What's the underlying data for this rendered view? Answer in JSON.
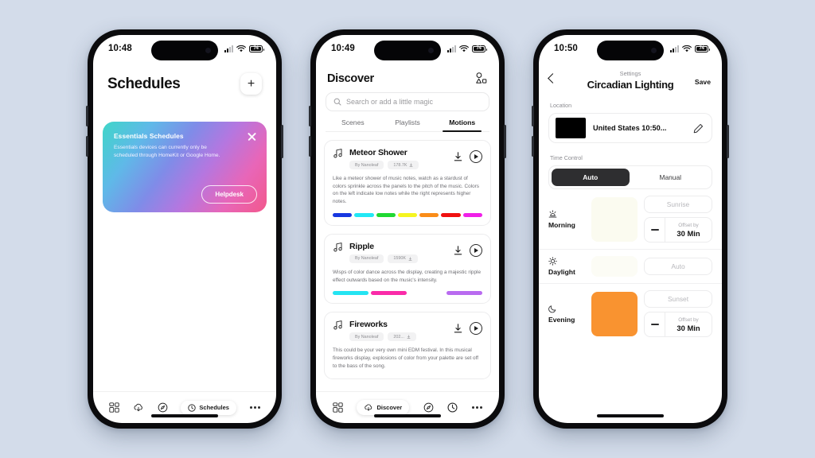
{
  "background_color": "#d3dcea",
  "phone1": {
    "status": {
      "time": "10:48",
      "battery": "74",
      "signal_icon": "signal-bars-icon",
      "wifi_icon": "wifi-icon",
      "battery_icon": "battery-icon"
    },
    "header": {
      "title": "Schedules",
      "add_button_label": "+"
    },
    "promo": {
      "title": "Essentials Schedules",
      "body": "Essentials devices can currently only be scheduled through HomeKit or Google Home.",
      "button_label": "Helpdesk",
      "close_icon": "close-icon",
      "gradient_from": "#3fd6c8",
      "gradient_to": "#f2588c"
    },
    "tabbar": {
      "items": [
        {
          "icon": "grid-icon",
          "label": "",
          "active": false
        },
        {
          "icon": "cloud-download-icon",
          "label": "",
          "active": false
        },
        {
          "icon": "compass-icon",
          "label": "",
          "active": false
        },
        {
          "icon": "clock-icon",
          "label": "Schedules",
          "active": true
        },
        {
          "icon": "more-dots-icon",
          "label": "",
          "active": false
        }
      ]
    }
  },
  "phone2": {
    "status": {
      "time": "10:49",
      "battery": "74"
    },
    "header": {
      "title": "Discover",
      "shapes_icon": "shapes-icon"
    },
    "search": {
      "placeholder": "Search or add a little magic",
      "icon": "search-icon"
    },
    "tabs": [
      {
        "label": "Scenes",
        "active": false
      },
      {
        "label": "Playlists",
        "active": false
      },
      {
        "label": "Motions",
        "active": true
      }
    ],
    "cards": [
      {
        "title": "Meteor Shower",
        "author": "By Nanoleaf",
        "count": "178.7K",
        "description": "Like a meteor shower of music notes, watch as a stardust of colors sprinkle across the panels to the pitch of the music. Colors on the left indicate low notes while the right represents higher notes.",
        "music_icon": "music-note-icon",
        "download_icon": "download-icon",
        "play_icon": "play-icon",
        "swatches": [
          "#1838e0",
          "#22e8f5",
          "#20d832",
          "#f5f520",
          "#fa8c18",
          "#f01010",
          "#f020e8"
        ]
      },
      {
        "title": "Ripple",
        "author": "By Nanoleaf",
        "count": "1590K",
        "description": "Wisps of color dance across the display, creating a majestic ripple effect outwards based on the music's intensity.",
        "music_icon": "music-note-icon",
        "download_icon": "download-icon",
        "play_icon": "play-icon",
        "swatches": [
          "#24e4f2",
          "#fa2ba8",
          "#ffffff",
          "#b96bf0"
        ]
      },
      {
        "title": "Fireworks",
        "author": "By Nanoleaf",
        "count": "202...",
        "description": "This could be your very own mini EDM festival. In this musical fireworks display, explosions of color from your palette are set off to the bass of the song.",
        "music_icon": "music-note-icon",
        "download_icon": "download-icon",
        "play_icon": "play-icon",
        "swatches": []
      }
    ],
    "tabbar": {
      "items": [
        {
          "icon": "grid-icon",
          "label": "",
          "active": false
        },
        {
          "icon": "cloud-download-icon",
          "label": "Discover",
          "active": true
        },
        {
          "icon": "compass-icon",
          "label": "",
          "active": false
        },
        {
          "icon": "clock-icon",
          "label": "",
          "active": false
        },
        {
          "icon": "more-dots-icon",
          "label": "",
          "active": false
        }
      ]
    }
  },
  "phone3": {
    "status": {
      "time": "10:50",
      "battery": "74"
    },
    "header": {
      "eyebrow": "Settings",
      "title": "Circadian Lighting",
      "save_label": "Save",
      "back_icon": "back-chevron-icon"
    },
    "location": {
      "section_label": "Location",
      "value": "United States 10:50...",
      "swatch_color": "#000000",
      "edit_icon": "pencil-icon"
    },
    "time_control": {
      "section_label": "Time Control",
      "segments": [
        {
          "label": "Auto",
          "active": true
        },
        {
          "label": "Manual",
          "active": false
        }
      ],
      "rows": [
        {
          "name": "Morning",
          "icon": "sunrise-icon",
          "swatch_color": "#fbfbf0",
          "mode_label": "Sunrise",
          "offset_caption": "Offset by",
          "offset_value": "30 Min",
          "has_offset": true
        },
        {
          "name": "Daylight",
          "icon": "sun-icon",
          "swatch_color": "#fcfcf5",
          "mode_label": "Auto",
          "offset_caption": "",
          "offset_value": "",
          "has_offset": false
        },
        {
          "name": "Evening",
          "icon": "moon-icon",
          "swatch_color": "#f99330",
          "mode_label": "Sunset",
          "offset_caption": "Offset by",
          "offset_value": "30 Min",
          "has_offset": true
        }
      ]
    }
  }
}
